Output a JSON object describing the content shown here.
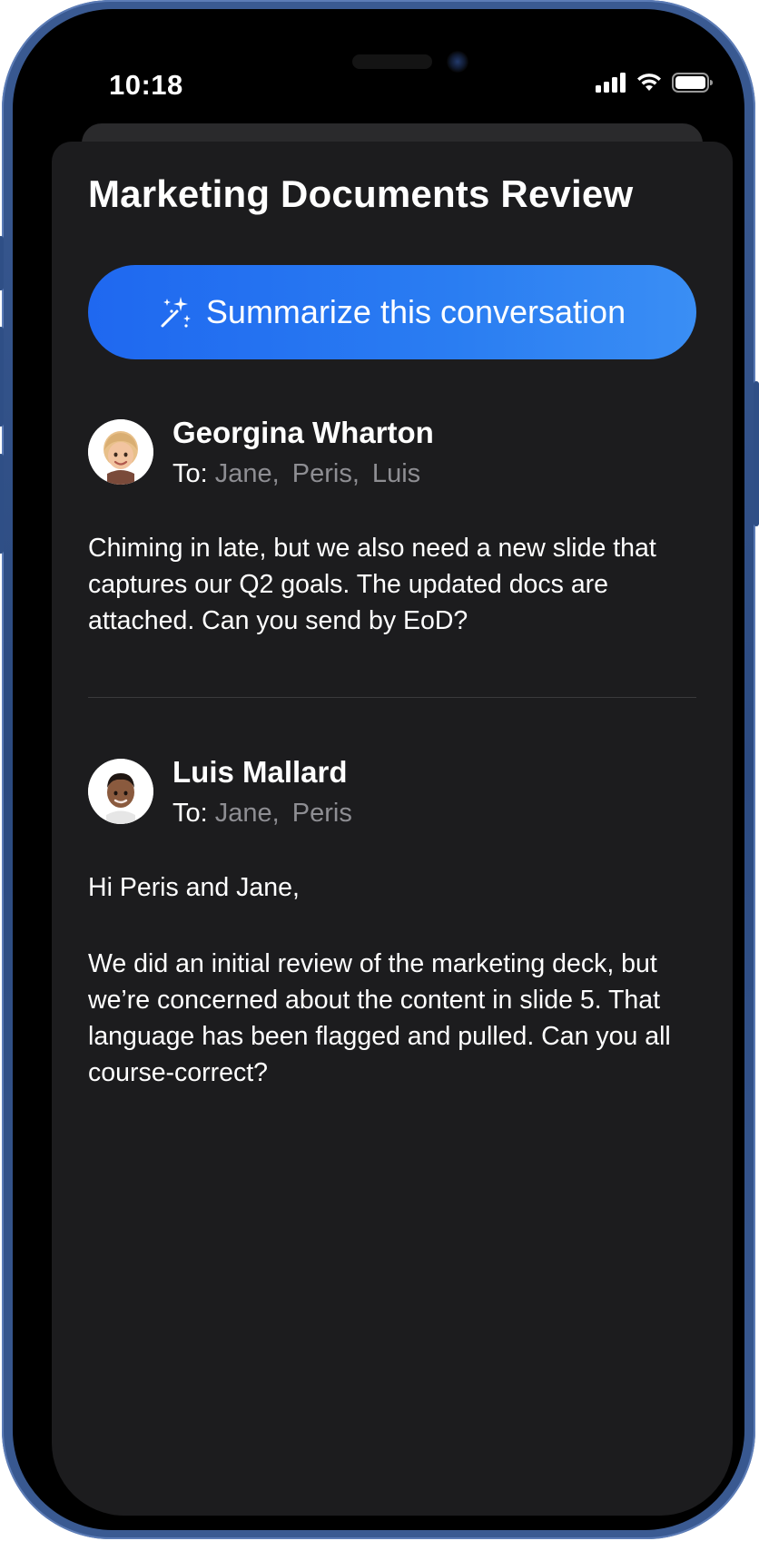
{
  "status_bar": {
    "time": "10:18",
    "icons": [
      "cellular-signal-icon",
      "wifi-icon",
      "battery-icon"
    ]
  },
  "sheet": {
    "title": "Marketing Documents Review",
    "summarize_button": {
      "icon": "sparkles-icon",
      "label": "Summarize this conversation",
      "colors": [
        "#1f68f0",
        "#3a8ef4"
      ]
    }
  },
  "messages": [
    {
      "sender": "Georgina Wharton",
      "to_label": "To:",
      "recipients": "Jane,  Peris,  Luis",
      "avatar": "memoji-avatar-blonde",
      "paragraphs": [
        "Chiming in late, but we also need a new slide that captures our Q2 goals. The updated docs are attached. Can you send by EoD?"
      ]
    },
    {
      "sender": "Luis Mallard",
      "to_label": "To:",
      "recipients": "Jane,  Peris",
      "avatar": "memoji-avatar-dark-hair",
      "paragraphs": [
        "Hi Peris and Jane,",
        "We did an initial review of the marketing deck, but we’re concerned about the content in slide 5. That language has been flagged and pulled. Can you all course-correct?"
      ]
    }
  ],
  "colors": {
    "sheet_background": "#1c1c1e",
    "secondary_text": "#8e8e93",
    "divider": "#3a3a3c"
  }
}
